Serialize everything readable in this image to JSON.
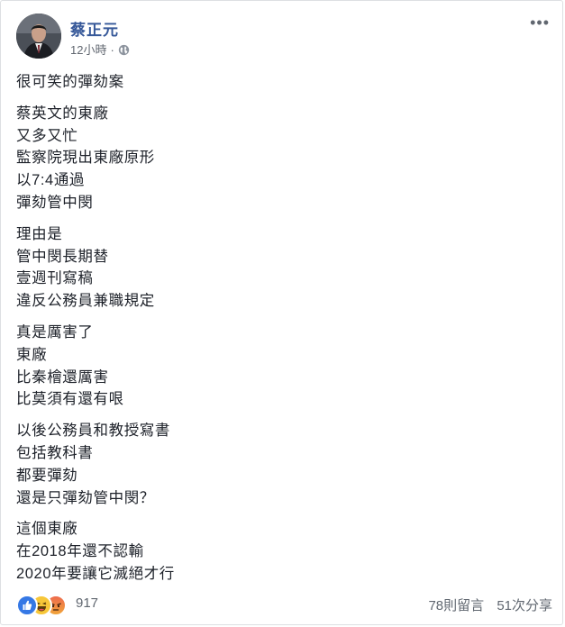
{
  "post": {
    "author": "蔡正元",
    "timestamp": "12小時",
    "separator": "·",
    "privacy_icon": "globe-icon",
    "more_icon": "more-options-icon",
    "more_glyph": "•••",
    "paragraphs": [
      [
        "很可笑的彈劾案"
      ],
      [
        "蔡英文的東廠",
        "又多又忙",
        "監察院現出東廠原形",
        "以7:4通過",
        "彈劾管中閔"
      ],
      [
        "理由是",
        "管中閔長期替",
        "壹週刊寫稿",
        "違反公務員兼職規定"
      ],
      [
        "真是厲害了",
        "東廠",
        "比秦檜還厲害",
        "比莫須有還有哏"
      ],
      [
        "以後公務員和教授寫書",
        "包括教科書",
        "都要彈劾",
        "還是只彈劾管中閔？"
      ],
      [
        "這個東廠",
        "在2018年還不認輸",
        "2020年要讓它滅絕才行"
      ]
    ]
  },
  "footer": {
    "reaction_icons": [
      "like-icon",
      "haha-icon",
      "angry-icon"
    ],
    "reaction_count": "917",
    "comments": "78則留言",
    "shares": "51次分享"
  },
  "colors": {
    "author_link": "#365899",
    "text": "#1d2129",
    "meta": "#616770",
    "like": "#3578e5",
    "haha": "#f7c739",
    "angry": "#ee6b4d"
  }
}
